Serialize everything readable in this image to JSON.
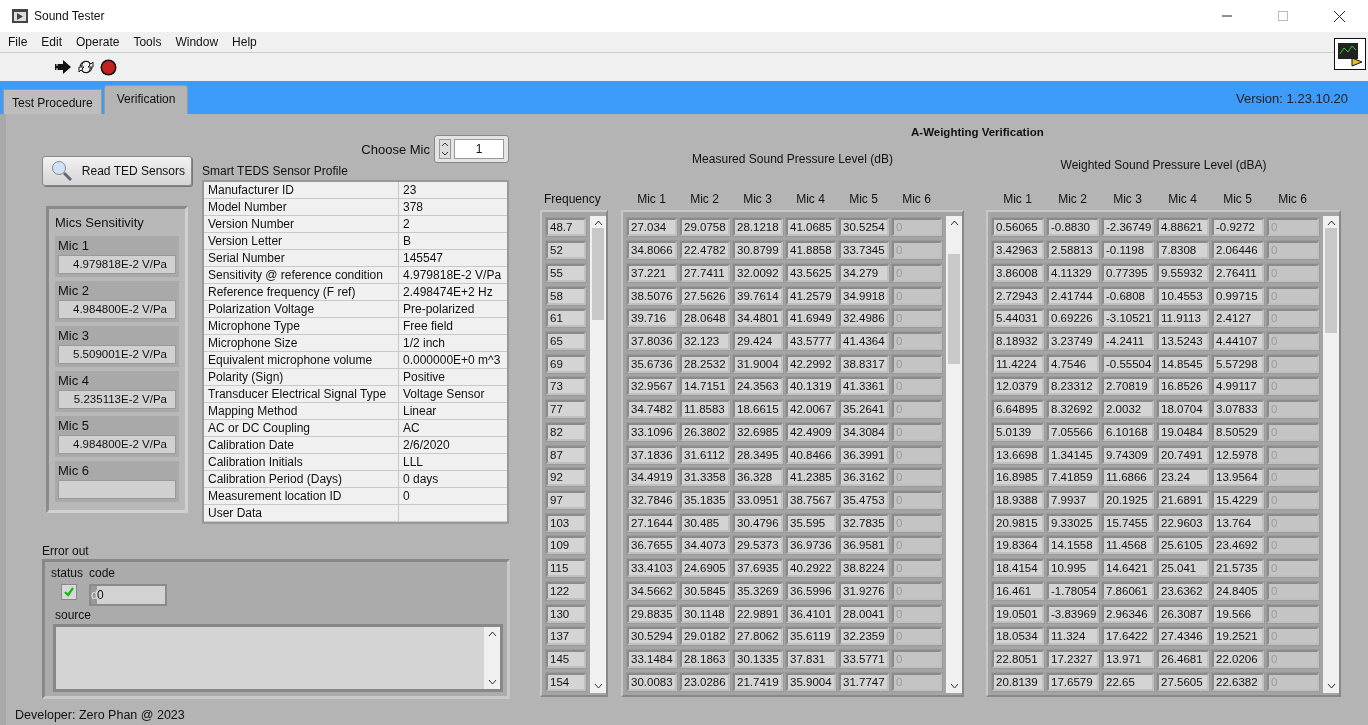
{
  "window": {
    "title": "Sound Tester"
  },
  "menu": [
    "File",
    "Edit",
    "Operate",
    "Tools",
    "Window",
    "Help"
  ],
  "tabs": [
    {
      "label": "Test Procedure",
      "selected": false
    },
    {
      "label": "Verification",
      "selected": true
    }
  ],
  "version": "Version: 1.23.10.20",
  "read_button": "Read TED Sensors",
  "mics_sensitivity": {
    "title": "Mics Sensitivity",
    "items": [
      {
        "label": "Mic 1",
        "value": "4.979818E-2 V/Pa"
      },
      {
        "label": "Mic 2",
        "value": "4.984800E-2 V/Pa"
      },
      {
        "label": "Mic 3",
        "value": "5.509001E-2 V/Pa"
      },
      {
        "label": "Mic 4",
        "value": "5.235113E-2 V/Pa"
      },
      {
        "label": "Mic 5",
        "value": "4.984800E-2 V/Pa"
      },
      {
        "label": "Mic 6"
      }
    ]
  },
  "choose_mic": {
    "label": "Choose Mic",
    "value": "1"
  },
  "teds": {
    "title": "Smart TEDS Sensor Profile",
    "rows": [
      [
        "Manufacturer ID",
        "23"
      ],
      [
        "Model Number",
        "378"
      ],
      [
        "Version Number",
        "2"
      ],
      [
        "Version Letter",
        "B"
      ],
      [
        "Serial Number",
        "145547"
      ],
      [
        "Sensitivity @ reference condition",
        "4.979818E-2 V/Pa"
      ],
      [
        "Reference frequency (F ref)",
        "2.498474E+2 Hz"
      ],
      [
        "Polarization Voltage",
        "Pre-polarized"
      ],
      [
        "Microphone Type",
        "Free field"
      ],
      [
        "Microphone Size",
        "1/2 inch"
      ],
      [
        "Equivalent microphone volume",
        "0.000000E+0  m^3"
      ],
      [
        "Polarity (Sign)",
        "Positive"
      ],
      [
        "Transducer Electrical Signal Type",
        "Voltage Sensor"
      ],
      [
        "Mapping Method",
        "Linear"
      ],
      [
        "AC or DC Coupling",
        "AC"
      ],
      [
        "Calibration Date",
        "2/6/2020"
      ],
      [
        "Calibration Initials",
        "LLL"
      ],
      [
        "Calibration Period (Days)",
        "0 days"
      ],
      [
        "Measurement location ID",
        "0"
      ],
      [
        "User Data"
      ]
    ]
  },
  "error_out": {
    "title": "Error out",
    "status_label": "status",
    "status_ok": true,
    "code_label": "code",
    "code_radix": "d",
    "code": "0",
    "source_label": "source"
  },
  "developer": "Developer: Zero Phan @ 2023",
  "verification": {
    "title": "A-Weighting Verification",
    "frequency": {
      "label": "Frequency",
      "values": [
        "48.7",
        "52",
        "55",
        "58",
        "61",
        "65",
        "69",
        "73",
        "77",
        "82",
        "87",
        "92",
        "97",
        "103",
        "109",
        "115",
        "122",
        "130",
        "137",
        "145",
        "154"
      ]
    },
    "measured": {
      "title": "Measured Sound Pressure Level (dB)",
      "columns": [
        {
          "label": "Mic 1",
          "disabled": false
        },
        {
          "label": "Mic 2",
          "disabled": false
        },
        {
          "label": "Mic 3",
          "disabled": false
        },
        {
          "label": "Mic 4",
          "disabled": false
        },
        {
          "label": "Mic 5",
          "disabled": false
        },
        {
          "label": "Mic 6",
          "disabled": true
        }
      ],
      "rows": [
        [
          "27.034",
          "29.0758",
          "28.1218",
          "41.0685",
          "30.5254",
          "0"
        ],
        [
          "34.8066",
          "22.4782",
          "30.8799",
          "41.8858",
          "33.7345",
          "0"
        ],
        [
          "37.221",
          "27.7411",
          "32.0092",
          "43.5625",
          "34.279",
          "0"
        ],
        [
          "38.5076",
          "27.5626",
          "39.7614",
          "41.2579",
          "34.9918",
          "0"
        ],
        [
          "39.716",
          "28.0648",
          "34.4801",
          "41.6949",
          "32.4986",
          "0"
        ],
        [
          "37.8036",
          "32.123",
          "29.424",
          "43.5777",
          "41.4364",
          "0"
        ],
        [
          "35.6736",
          "28.2532",
          "31.9004",
          "42.2992",
          "38.8317",
          "0"
        ],
        [
          "32.9567",
          "14.7151",
          "24.3563",
          "40.1319",
          "41.3361",
          "0"
        ],
        [
          "34.7482",
          "11.8583",
          "18.6615",
          "42.0067",
          "35.2641",
          "0"
        ],
        [
          "33.1096",
          "26.3802",
          "32.6985",
          "42.4909",
          "34.3084",
          "0"
        ],
        [
          "37.1836",
          "31.6112",
          "28.3495",
          "40.8466",
          "36.3991",
          "0"
        ],
        [
          "34.4919",
          "31.3358",
          "36.328",
          "41.2385",
          "36.3162",
          "0"
        ],
        [
          "32.7846",
          "35.1835",
          "33.0951",
          "38.7567",
          "35.4753",
          "0"
        ],
        [
          "27.1644",
          "30.485",
          "30.4796",
          "35.595",
          "32.7835",
          "0"
        ],
        [
          "36.7655",
          "34.4073",
          "29.5373",
          "36.9736",
          "36.9581",
          "0"
        ],
        [
          "33.4103",
          "24.6905",
          "37.6935",
          "40.2922",
          "38.8224",
          "0"
        ],
        [
          "34.5662",
          "30.5845",
          "35.3269",
          "36.5996",
          "31.9276",
          "0"
        ],
        [
          "29.8835",
          "30.1148",
          "22.9891",
          "36.4101",
          "28.0041",
          "0"
        ],
        [
          "30.5294",
          "29.0182",
          "27.8062",
          "35.6119",
          "32.2359",
          "0"
        ],
        [
          "33.1484",
          "28.1863",
          "30.1335",
          "37.831",
          "33.5771",
          "0"
        ],
        [
          "30.0083",
          "23.0286",
          "21.7419",
          "35.9004",
          "31.7747",
          "0"
        ]
      ]
    },
    "weighted": {
      "title": "Weighted Sound Pressure Level (dBA)",
      "columns": [
        {
          "label": "Mic 1",
          "disabled": false
        },
        {
          "label": "Mic 2",
          "disabled": false
        },
        {
          "label": "Mic 3",
          "disabled": false
        },
        {
          "label": "Mic 4",
          "disabled": false
        },
        {
          "label": "Mic 5",
          "disabled": false
        },
        {
          "label": "Mic 6",
          "disabled": true
        }
      ],
      "rows": [
        [
          "0.56065",
          "-0.8830",
          "-2.36749",
          "4.88621",
          "-0.9272",
          "0"
        ],
        [
          "3.42963",
          "2.58813",
          "-0.1198",
          "7.8308",
          "2.06446",
          "0"
        ],
        [
          "3.86008",
          "4.11329",
          "0.77395",
          "9.55932",
          "2.76411",
          "0"
        ],
        [
          "2.72943",
          "2.41744",
          "-0.6808",
          "10.4553",
          "0.99715",
          "0"
        ],
        [
          "5.44031",
          "0.69226",
          "-3.10521",
          "11.9113",
          "2.4127",
          "0"
        ],
        [
          "8.18932",
          "3.23749",
          "-4.2411",
          "13.5243",
          "4.44107",
          "0"
        ],
        [
          "11.4224",
          "4.7546",
          "-0.55504",
          "14.8545",
          "5.57298",
          "0"
        ],
        [
          "12.0379",
          "8.23312",
          "2.70819",
          "16.8526",
          "4.99117",
          "0"
        ],
        [
          "6.64895",
          "8.32692",
          "2.0032",
          "18.0704",
          "3.07833",
          "0"
        ],
        [
          "5.0139",
          "7.05566",
          "6.10168",
          "19.0484",
          "8.50529",
          "0"
        ],
        [
          "13.6698",
          "1.34145",
          "9.74309",
          "20.7491",
          "12.5978",
          "0"
        ],
        [
          "16.8985",
          "7.41859",
          "11.6866",
          "23.24",
          "13.9564",
          "0"
        ],
        [
          "18.9388",
          "7.9937",
          "20.1925",
          "21.6891",
          "15.4229",
          "0"
        ],
        [
          "20.9815",
          "9.33025",
          "15.7455",
          "22.9603",
          "13.764",
          "0"
        ],
        [
          "19.8364",
          "14.1558",
          "11.4568",
          "25.6105",
          "23.4692",
          "0"
        ],
        [
          "18.4154",
          "10.995",
          "14.6421",
          "25.041",
          "21.5735",
          "0"
        ],
        [
          "16.461",
          "-1.78054",
          "7.86061",
          "23.6362",
          "24.8405",
          "0"
        ],
        [
          "19.0501",
          "-3.83969",
          "2.96346",
          "26.3087",
          "19.566",
          "0"
        ],
        [
          "18.0534",
          "11.324",
          "17.6422",
          "27.4346",
          "19.2521",
          "0"
        ],
        [
          "22.8051",
          "17.2327",
          "13.971",
          "26.4681",
          "22.0206",
          "0"
        ],
        [
          "20.8139",
          "17.6579",
          "22.65",
          "27.5605",
          "22.6382",
          "0"
        ]
      ]
    }
  }
}
